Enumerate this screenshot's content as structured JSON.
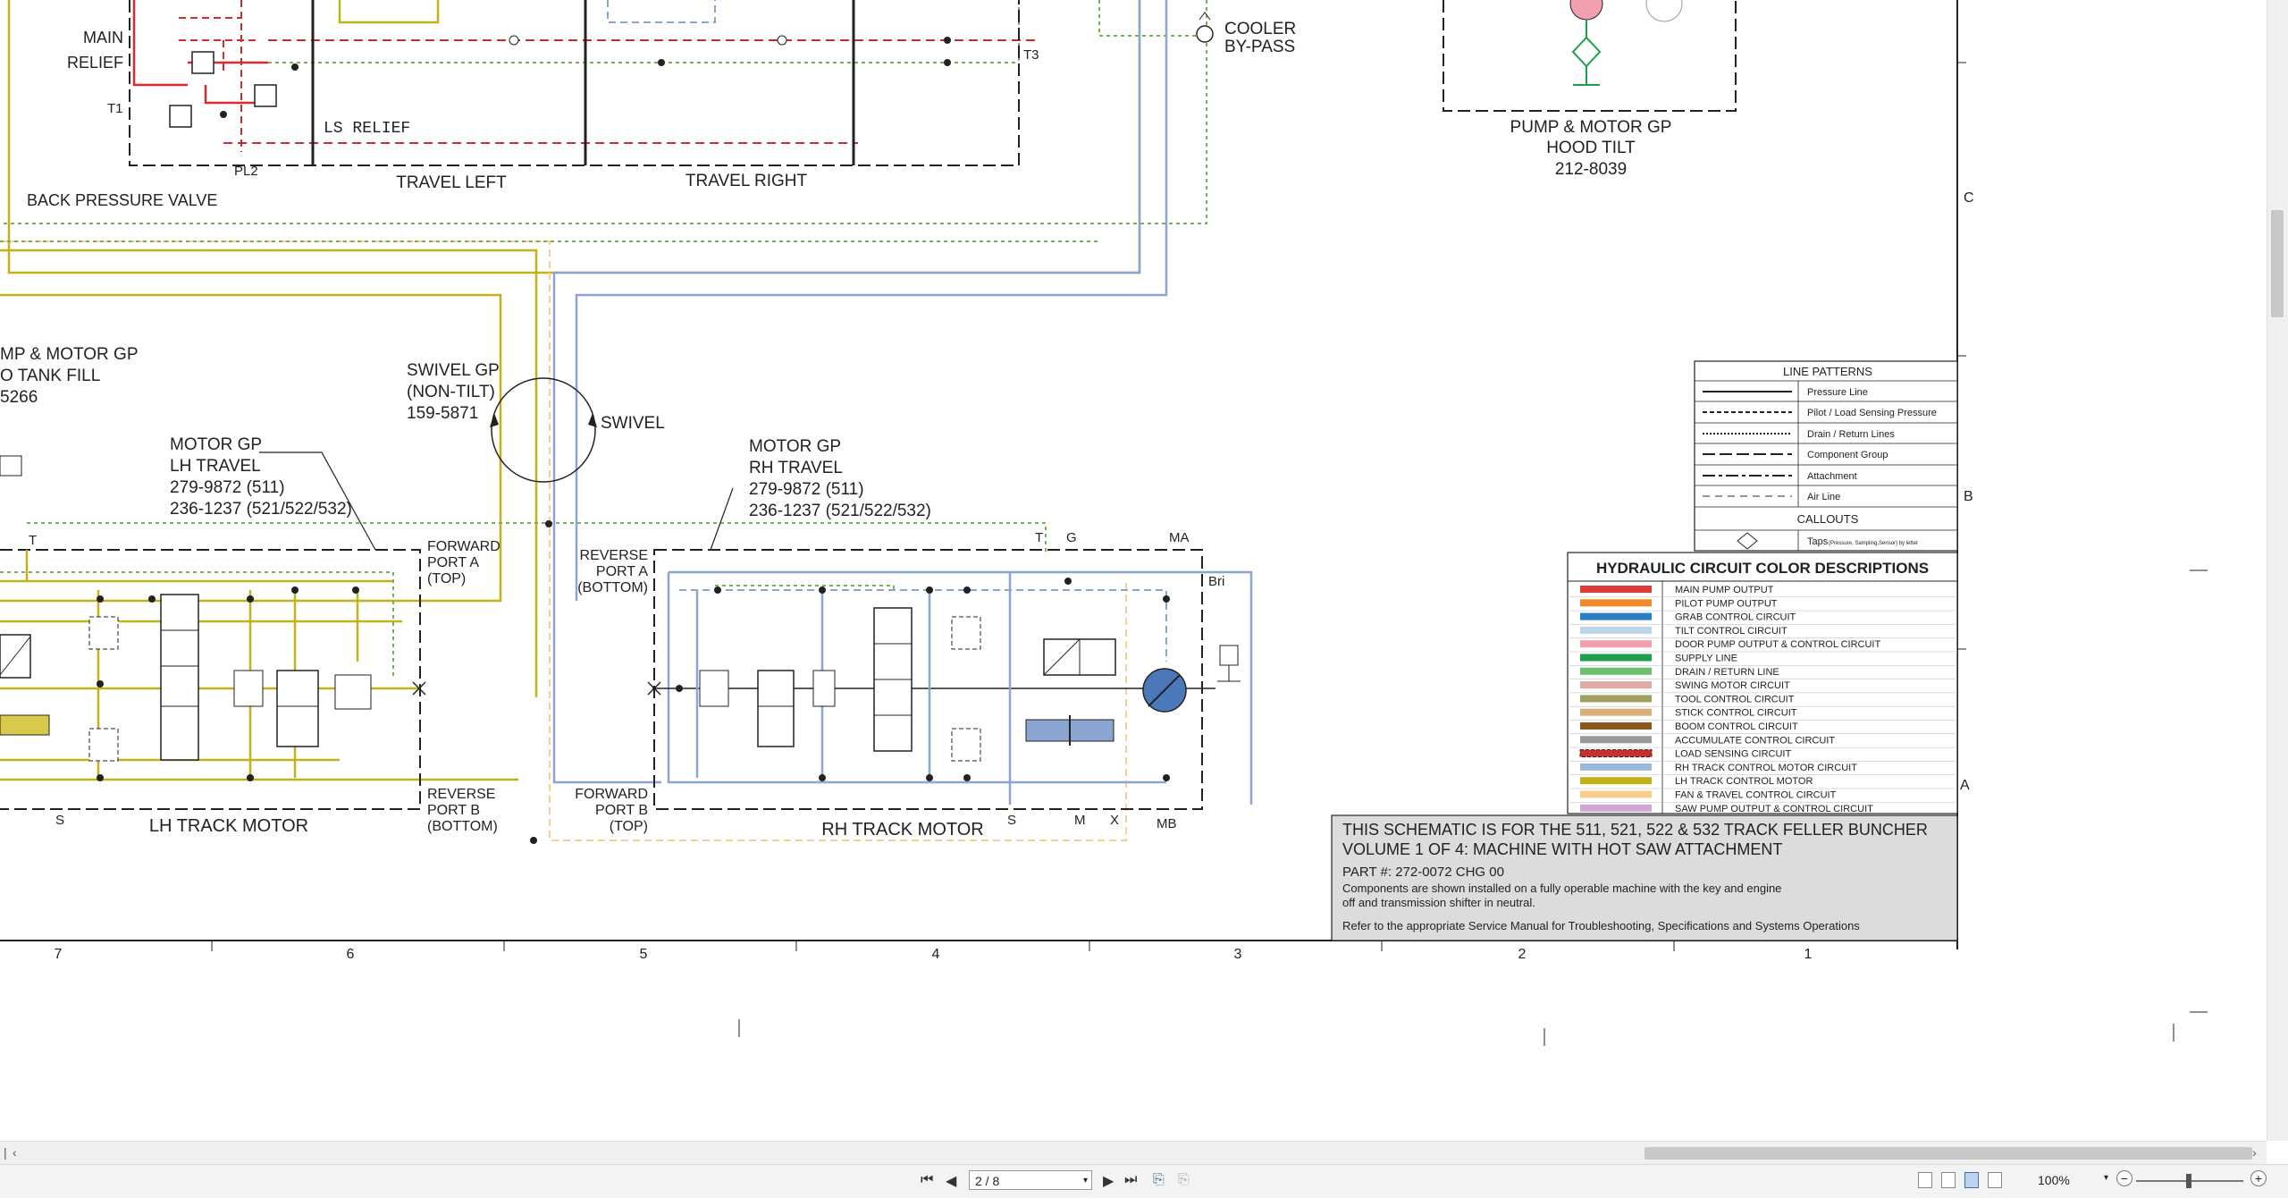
{
  "diagram": {
    "labels": {
      "main_relief": [
        "MAIN",
        "RELIEF"
      ],
      "t1": "T1",
      "back_pressure": "BACK PRESSURE VALVE",
      "pl2": "PL2",
      "ls_relief": "LS RELIEF",
      "travel_left": "TRAVEL LEFT",
      "travel_right": "TRAVEL RIGHT",
      "t3": "T3",
      "cooler_bypass": [
        "COOLER",
        "BY-PASS"
      ],
      "hood_tilt": [
        "PUMP & MOTOR GP",
        "HOOD TILT",
        "212-8039"
      ],
      "tank_fill": [
        "MP & MOTOR GP",
        "O TANK FILL",
        "5266"
      ],
      "swivel_gp": [
        "SWIVEL GP",
        "(NON-TILT)",
        "159-5871"
      ],
      "swivel": "SWIVEL",
      "lh_motor_gp": [
        "MOTOR GP",
        "LH TRAVEL",
        "279-9872 (511)",
        "236-1237 (521/522/532)"
      ],
      "rh_motor_gp": [
        "MOTOR GP",
        "RH TRAVEL",
        "279-9872 (511)",
        "236-1237 (521/522/532)"
      ],
      "lh_forward": [
        "FORWARD",
        "PORT A",
        "(TOP)"
      ],
      "lh_reverse": [
        "REVERSE",
        "PORT B",
        "(BOTTOM)"
      ],
      "rh_reverse": [
        "REVERSE",
        "PORT A",
        "(BOTTOM)"
      ],
      "rh_forward": [
        "FORWARD",
        "PORT B",
        "(TOP)"
      ],
      "lh_track_motor": "LH TRACK MOTOR",
      "rh_track_motor": "RH TRACK MOTOR",
      "port_t_left": "T",
      "port_s_left": "S",
      "port_t": "T",
      "port_g": "G",
      "port_ma": "MA",
      "bri": "Bri",
      "port_s": "S",
      "port_m": "M",
      "port_x": "X",
      "port_mb": "MB"
    },
    "line_patterns": {
      "title": "LINE PATTERNS",
      "items": [
        "Pressure Line",
        "Pilot / Load Sensing Pressure",
        "Drain / Return Lines",
        "Component Group",
        "Attachment",
        "Air Line"
      ],
      "callouts_title": "CALLOUTS",
      "taps_label": "Taps",
      "taps_sub": "(Pressure, Sampling,Sensor) by letter"
    },
    "color_legend": {
      "title": "HYDRAULIC CIRCUIT COLOR DESCRIPTIONS",
      "items": [
        {
          "label": "MAIN PUMP OUTPUT",
          "color": "#e03a3a"
        },
        {
          "label": "PILOT PUMP OUTPUT",
          "color": "#f08a2a"
        },
        {
          "label": "GRAB CONTROL CIRCUIT",
          "color": "#2a7fc4"
        },
        {
          "label": "TILT CONTROL CIRCUIT",
          "color": "#bcd3e8"
        },
        {
          "label": "DOOR PUMP OUTPUT & CONTROL CIRCUIT",
          "color": "#f2a0b0"
        },
        {
          "label": "SUPPLY LINE",
          "color": "#1e9e4a"
        },
        {
          "label": "DRAIN / RETURN LINE",
          "color": "#6cc070"
        },
        {
          "label": "SWING MOTOR CIRCUIT",
          "color": "#e3a9a9"
        },
        {
          "label": "TOOL CONTROL CIRCUIT",
          "color": "#a0a060"
        },
        {
          "label": "STICK CONTROL CIRCUIT",
          "color": "#d9b07a"
        },
        {
          "label": "BOOM CONTROL CIRCUIT",
          "color": "#8a5a1c"
        },
        {
          "label": "ACCUMULATE CONTROL CIRCUIT",
          "color": "#9a9a9a"
        },
        {
          "label": "LOAD SENSING CIRCUIT",
          "color": "#c83030"
        },
        {
          "label": "RH TRACK CONTROL MOTOR CIRCUIT",
          "color": "#9ab8dc"
        },
        {
          "label": "LH TRACK CONTROL MOTOR",
          "color": "#c2b21a"
        },
        {
          "label": "FAN & TRAVEL CONTROL CIRCUIT",
          "color": "#f6cf8c"
        },
        {
          "label": "SAW PUMP OUTPUT & CONTROL CIRCUIT",
          "color": "#d2a6d2"
        }
      ]
    },
    "title_block": {
      "line1": "THIS SCHEMATIC IS FOR THE 511, 521, 522 & 532 TRACK FELLER BUNCHER",
      "line2": "VOLUME 1 OF 4: MACHINE WITH HOT SAW ATTACHMENT",
      "part": "PART #: 272-0072 CHG 00",
      "note1": "Components are shown installed on a fully operable machine with the key and engine",
      "note2": "off and transmission shifter in neutral.",
      "note3": "Refer to the appropriate Service Manual for Troubleshooting, Specifications and Systems Operations"
    },
    "column_numbers": [
      "7",
      "6",
      "5",
      "4",
      "3",
      "2",
      "1"
    ],
    "row_letters": [
      "C",
      "B",
      "A"
    ]
  },
  "viewer": {
    "page_current": "2 / 8",
    "zoom": "100%",
    "buttons": {
      "first_page": "first-page",
      "prev_page": "previous-page",
      "next_page": "next-page",
      "last_page": "last-page"
    }
  }
}
